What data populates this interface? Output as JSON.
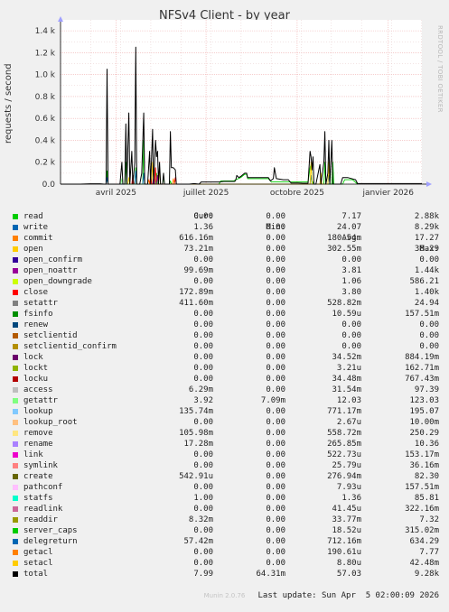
{
  "title": "NFSv4 Client - by year",
  "side_note": "RRDTOOL / TOBI OETIKER",
  "footer": "Munin 2.0.76",
  "legend_header": {
    "cur": "Cur:",
    "min": "Min:",
    "avg": "Avg:",
    "max": "Max:"
  },
  "legend": [
    {
      "name": "read",
      "color": "#00cc00",
      "cur": "0.00",
      "min": "0.00",
      "avg": "7.17",
      "max": "2.88k"
    },
    {
      "name": "write",
      "color": "#0066b3",
      "cur": "1.36",
      "min": "0.00",
      "avg": "24.07",
      "max": "8.29k"
    },
    {
      "name": "commit",
      "color": "#ff8000",
      "cur": "616.16m",
      "min": "0.00",
      "avg": "180.54m",
      "max": "17.27"
    },
    {
      "name": "open",
      "color": "#ffcc00",
      "cur": "73.21m",
      "min": "0.00",
      "avg": "302.55m",
      "max": "38.29"
    },
    {
      "name": "open_confirm",
      "color": "#330099",
      "cur": "0.00",
      "min": "0.00",
      "avg": "0.00",
      "max": "0.00"
    },
    {
      "name": "open_noattr",
      "color": "#990099",
      "cur": "99.69m",
      "min": "0.00",
      "avg": "3.81",
      "max": "1.44k"
    },
    {
      "name": "open_downgrade",
      "color": "#ccff00",
      "cur": "0.00",
      "min": "0.00",
      "avg": "1.06",
      "max": "586.21"
    },
    {
      "name": "close",
      "color": "#ff0000",
      "cur": "172.89m",
      "min": "0.00",
      "avg": "3.80",
      "max": "1.40k"
    },
    {
      "name": "setattr",
      "color": "#808080",
      "cur": "411.60m",
      "min": "0.00",
      "avg": "528.82m",
      "max": "24.94"
    },
    {
      "name": "fsinfo",
      "color": "#008f00",
      "cur": "0.00",
      "min": "0.00",
      "avg": "10.59u",
      "max": "157.51m"
    },
    {
      "name": "renew",
      "color": "#00487d",
      "cur": "0.00",
      "min": "0.00",
      "avg": "0.00",
      "max": "0.00"
    },
    {
      "name": "setclientid",
      "color": "#b35a00",
      "cur": "0.00",
      "min": "0.00",
      "avg": "0.00",
      "max": "0.00"
    },
    {
      "name": "setclientid_confirm",
      "color": "#b38f00",
      "cur": "0.00",
      "min": "0.00",
      "avg": "0.00",
      "max": "0.00"
    },
    {
      "name": "lock",
      "color": "#6b006b",
      "cur": "0.00",
      "min": "0.00",
      "avg": "34.52m",
      "max": "884.19m"
    },
    {
      "name": "lockt",
      "color": "#8fb300",
      "cur": "0.00",
      "min": "0.00",
      "avg": "3.21u",
      "max": "162.71m"
    },
    {
      "name": "locku",
      "color": "#b30000",
      "cur": "0.00",
      "min": "0.00",
      "avg": "34.48m",
      "max": "767.43m"
    },
    {
      "name": "access",
      "color": "#bebebe",
      "cur": "6.29m",
      "min": "0.00",
      "avg": "31.54m",
      "max": "97.39"
    },
    {
      "name": "getattr",
      "color": "#80ff80",
      "cur": "3.92",
      "min": "7.09m",
      "avg": "12.03",
      "max": "123.03"
    },
    {
      "name": "lookup",
      "color": "#80c9ff",
      "cur": "135.74m",
      "min": "0.00",
      "avg": "771.17m",
      "max": "195.07"
    },
    {
      "name": "lookup_root",
      "color": "#ffc080",
      "cur": "0.00",
      "min": "0.00",
      "avg": "2.67u",
      "max": "10.00m"
    },
    {
      "name": "remove",
      "color": "#ffe680",
      "cur": "105.98m",
      "min": "0.00",
      "avg": "558.72m",
      "max": "250.29"
    },
    {
      "name": "rename",
      "color": "#aa80ff",
      "cur": "17.28m",
      "min": "0.00",
      "avg": "265.85m",
      "max": "10.36"
    },
    {
      "name": "link",
      "color": "#ee00cc",
      "cur": "0.00",
      "min": "0.00",
      "avg": "522.73u",
      "max": "153.17m"
    },
    {
      "name": "symlink",
      "color": "#ff8080",
      "cur": "0.00",
      "min": "0.00",
      "avg": "25.79u",
      "max": "36.16m"
    },
    {
      "name": "create",
      "color": "#666600",
      "cur": "542.91u",
      "min": "0.00",
      "avg": "276.94m",
      "max": "82.30"
    },
    {
      "name": "pathconf",
      "color": "#ffbfff",
      "cur": "0.00",
      "min": "0.00",
      "avg": "7.93u",
      "max": "157.51m"
    },
    {
      "name": "statfs",
      "color": "#00ffcc",
      "cur": "1.00",
      "min": "0.00",
      "avg": "1.36",
      "max": "85.81"
    },
    {
      "name": "readlink",
      "color": "#cc6699",
      "cur": "0.00",
      "min": "0.00",
      "avg": "41.45u",
      "max": "322.16m"
    },
    {
      "name": "readdir",
      "color": "#999900",
      "cur": "8.32m",
      "min": "0.00",
      "avg": "33.77m",
      "max": "7.32"
    },
    {
      "name": "server_caps",
      "color": "#00cc00",
      "cur": "0.00",
      "min": "0.00",
      "avg": "18.52u",
      "max": "315.02m"
    },
    {
      "name": "delegreturn",
      "color": "#0066b3",
      "cur": "57.42m",
      "min": "0.00",
      "avg": "712.16m",
      "max": "634.29"
    },
    {
      "name": "getacl",
      "color": "#ff8000",
      "cur": "0.00",
      "min": "0.00",
      "avg": "190.61u",
      "max": "7.77"
    },
    {
      "name": "setacl",
      "color": "#ffcc00",
      "cur": "0.00",
      "min": "0.00",
      "avg": "8.80u",
      "max": "42.48m"
    },
    {
      "name": "total",
      "color": "#000000",
      "cur": "7.99",
      "min": "64.31m",
      "avg": "57.03",
      "max": "9.28k"
    }
  ],
  "last_update": "Last update: Sun Apr  5 02:00:09 2026",
  "chart_data": {
    "type": "line",
    "title": "NFSv4 Client - by year",
    "ylabel": "requests / second",
    "xlabel": "",
    "ylim": [
      0,
      1500
    ],
    "y_ticks": [
      0,
      200,
      400,
      600,
      800,
      1000,
      1200,
      1400
    ],
    "y_tick_labels": [
      "0.0",
      "0.2 k",
      "0.4 k",
      "0.6 k",
      "0.8 k",
      "1.0 k",
      "1.2 k",
      "1.4 k"
    ],
    "x_range": [
      0,
      365
    ],
    "x_ticks": [
      {
        "x": 56,
        "label": "avril 2025"
      },
      {
        "x": 147,
        "label": "juillet 2025"
      },
      {
        "x": 239,
        "label": "octobre 2025"
      },
      {
        "x": 331,
        "label": "janvier 2026"
      }
    ],
    "grid": true,
    "series": [
      {
        "name": "total",
        "color": "#000000",
        "points": [
          [
            0,
            0
          ],
          [
            20,
            0
          ],
          [
            30,
            3
          ],
          [
            40,
            3
          ],
          [
            44,
            0
          ],
          [
            46,
            0
          ],
          [
            47,
            1050
          ],
          [
            48,
            0
          ],
          [
            60,
            0
          ],
          [
            62,
            200
          ],
          [
            63,
            0
          ],
          [
            65,
            0
          ],
          [
            66,
            550
          ],
          [
            67,
            0
          ],
          [
            69,
            650
          ],
          [
            70,
            0
          ],
          [
            72,
            300
          ],
          [
            73,
            0
          ],
          [
            75,
            200
          ],
          [
            76,
            1250
          ],
          [
            77,
            0
          ],
          [
            80,
            0
          ],
          [
            82,
            100
          ],
          [
            84,
            650
          ],
          [
            85,
            0
          ],
          [
            88,
            0
          ],
          [
            90,
            300
          ],
          [
            91,
            0
          ],
          [
            93,
            500
          ],
          [
            94,
            0
          ],
          [
            96,
            400
          ],
          [
            97,
            250
          ],
          [
            98,
            300
          ],
          [
            99,
            0
          ],
          [
            100,
            200
          ],
          [
            101,
            0
          ],
          [
            103,
            0
          ],
          [
            104,
            100
          ],
          [
            105,
            0
          ],
          [
            110,
            0
          ],
          [
            111,
            480
          ],
          [
            112,
            150
          ],
          [
            114,
            150
          ],
          [
            116,
            130
          ],
          [
            117,
            0
          ],
          [
            130,
            0
          ],
          [
            135,
            5
          ],
          [
            140,
            0
          ],
          [
            142,
            20
          ],
          [
            160,
            20
          ],
          [
            165,
            25
          ],
          [
            176,
            25
          ],
          [
            177,
            40
          ],
          [
            178,
            80
          ],
          [
            180,
            60
          ],
          [
            182,
            70
          ],
          [
            186,
            100
          ],
          [
            188,
            100
          ],
          [
            189,
            60
          ],
          [
            200,
            60
          ],
          [
            205,
            60
          ],
          [
            210,
            60
          ],
          [
            212,
            30
          ],
          [
            215,
            50
          ],
          [
            216,
            150
          ],
          [
            217,
            100
          ],
          [
            218,
            50
          ],
          [
            225,
            40
          ],
          [
            230,
            40
          ],
          [
            233,
            10
          ],
          [
            240,
            10
          ],
          [
            245,
            8
          ],
          [
            250,
            8
          ],
          [
            252,
            300
          ],
          [
            253,
            250
          ],
          [
            254,
            130
          ],
          [
            255,
            250
          ],
          [
            256,
            0
          ],
          [
            258,
            0
          ],
          [
            262,
            180
          ],
          [
            263,
            0
          ],
          [
            266,
            200
          ],
          [
            267,
            480
          ],
          [
            268,
            0
          ],
          [
            270,
            100
          ],
          [
            271,
            400
          ],
          [
            272,
            0
          ],
          [
            274,
            400
          ],
          [
            275,
            0
          ],
          [
            280,
            0
          ],
          [
            283,
            0
          ],
          [
            285,
            60
          ],
          [
            290,
            60
          ],
          [
            298,
            40
          ],
          [
            300,
            5
          ],
          [
            365,
            5
          ]
        ]
      },
      {
        "name": "read",
        "color": "#00cc00",
        "points": [
          [
            46,
            0
          ],
          [
            47,
            120
          ],
          [
            48,
            0
          ],
          [
            65,
            0
          ],
          [
            66,
            200
          ],
          [
            67,
            0
          ],
          [
            75,
            0
          ],
          [
            76,
            150
          ],
          [
            77,
            0
          ],
          [
            83,
            0
          ],
          [
            84,
            400
          ],
          [
            85,
            0
          ],
          [
            96,
            0
          ],
          [
            97,
            100
          ],
          [
            98,
            0
          ],
          [
            110,
            0
          ],
          [
            111,
            30
          ],
          [
            112,
            0
          ],
          [
            160,
            0
          ],
          [
            162,
            30
          ],
          [
            175,
            30
          ],
          [
            177,
            40
          ],
          [
            182,
            60
          ],
          [
            186,
            90
          ],
          [
            188,
            90
          ],
          [
            189,
            50
          ],
          [
            210,
            50
          ],
          [
            213,
            20
          ],
          [
            250,
            20
          ],
          [
            252,
            150
          ],
          [
            253,
            180
          ],
          [
            254,
            30
          ],
          [
            256,
            0
          ],
          [
            266,
            0
          ],
          [
            267,
            200
          ],
          [
            268,
            0
          ],
          [
            274,
            0
          ],
          [
            275,
            200
          ],
          [
            276,
            0
          ],
          [
            285,
            0
          ],
          [
            287,
            40
          ],
          [
            295,
            40
          ],
          [
            300,
            0
          ]
        ]
      },
      {
        "name": "write",
        "color": "#0066b3",
        "points": [
          [
            46,
            0
          ],
          [
            47,
            60
          ],
          [
            48,
            0
          ],
          [
            75,
            0
          ],
          [
            76,
            120
          ],
          [
            77,
            0
          ],
          [
            83,
            0
          ],
          [
            84,
            100
          ],
          [
            85,
            0
          ],
          [
            252,
            0
          ],
          [
            253,
            80
          ],
          [
            254,
            0
          ],
          [
            270,
            0
          ],
          [
            271,
            80
          ],
          [
            272,
            0
          ]
        ]
      },
      {
        "name": "open",
        "color": "#ffcc00",
        "points": [
          [
            68,
            0
          ],
          [
            69,
            60
          ],
          [
            70,
            0
          ],
          [
            92,
            0
          ],
          [
            93,
            200
          ],
          [
            94,
            0
          ],
          [
            99,
            0
          ],
          [
            100,
            150
          ],
          [
            101,
            0
          ],
          [
            252,
            0
          ],
          [
            253,
            200
          ],
          [
            254,
            0
          ],
          [
            262,
            0
          ],
          [
            263,
            100
          ],
          [
            264,
            0
          ],
          [
            270,
            0
          ],
          [
            271,
            200
          ],
          [
            272,
            0
          ]
        ]
      },
      {
        "name": "close",
        "color": "#ff0000",
        "points": [
          [
            72,
            0
          ],
          [
            73,
            80
          ],
          [
            74,
            0
          ],
          [
            90,
            0
          ],
          [
            91,
            80
          ],
          [
            92,
            0
          ],
          [
            95,
            0
          ],
          [
            96,
            150
          ],
          [
            97,
            0
          ],
          [
            115,
            0
          ],
          [
            116,
            60
          ],
          [
            117,
            0
          ]
        ]
      },
      {
        "name": "open_noattr",
        "color": "#990099",
        "points": [
          [
            93,
            0
          ],
          [
            94,
            60
          ],
          [
            95,
            0
          ],
          [
            97,
            0
          ],
          [
            98,
            80
          ],
          [
            99,
            0
          ]
        ]
      },
      {
        "name": "getattr",
        "color": "#80ff80",
        "points": [
          [
            61,
            0
          ],
          [
            62,
            50
          ],
          [
            63,
            0
          ],
          [
            103,
            0
          ],
          [
            104,
            60
          ],
          [
            105,
            0
          ]
        ]
      },
      {
        "name": "commit",
        "color": "#ff8000",
        "points": [
          [
            88,
            0
          ],
          [
            89,
            40
          ],
          [
            90,
            0
          ],
          [
            113,
            0
          ],
          [
            114,
            50
          ],
          [
            115,
            0
          ]
        ]
      }
    ]
  }
}
